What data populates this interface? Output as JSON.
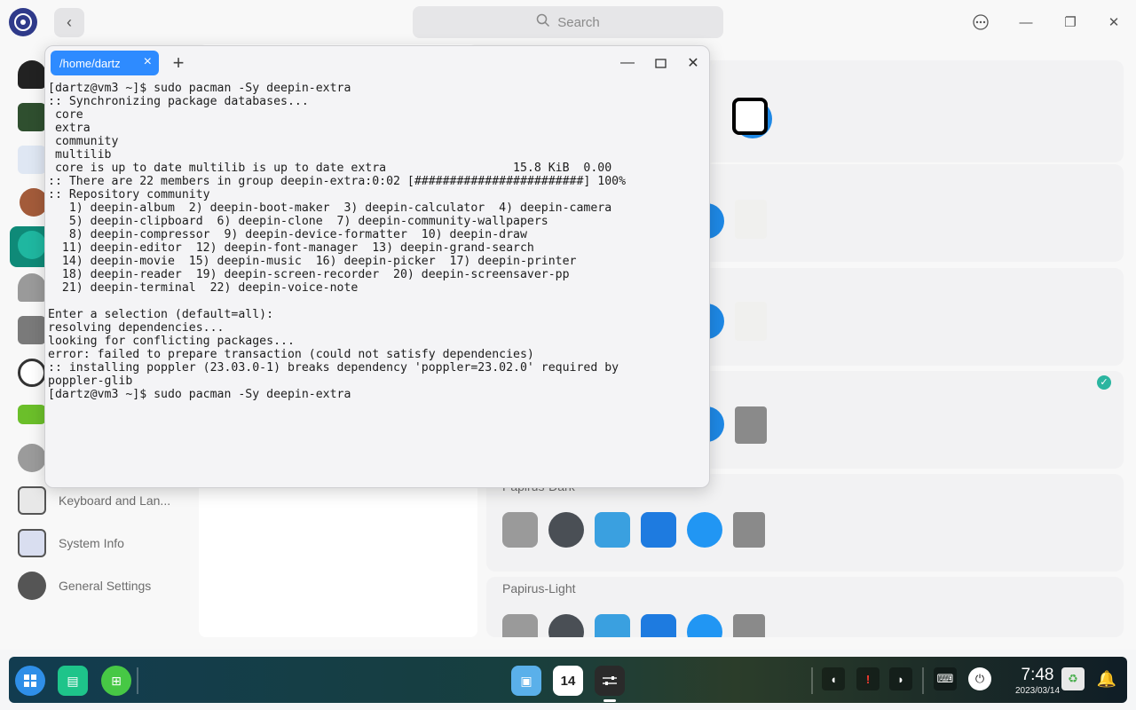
{
  "window": {
    "search_placeholder": "Search",
    "back_icon": "chevron-left-icon",
    "menu_icon": "more-icon",
    "min_icon": "minimize-icon",
    "max_icon": "maximize-icon",
    "close_icon": "close-icon"
  },
  "sidebar": {
    "items": [
      {
        "label": "Keyboard and Lan...",
        "icon": "keyboard-icon"
      },
      {
        "label": "System Info",
        "icon": "system-info-icon"
      },
      {
        "label": "General Settings",
        "icon": "gear-icon"
      }
    ]
  },
  "themes": {
    "items": [
      {
        "name": "Papirus-Dark"
      },
      {
        "name": "Papirus-Light"
      }
    ]
  },
  "terminal": {
    "tab_label": "/home/dartz",
    "close_tab": "×",
    "new_tab": "+",
    "output": "[dartz@vm3 ~]$ sudo pacman -Sy deepin-extra\n:: Synchronizing package databases...\n core\n extra\n community\n multilib\n core is up to date multilib is up to date extra                  15.8 KiB  0.00\n:: There are 22 members in group deepin-extra:0:02 [########################] 100%\n:: Repository community\n   1) deepin-album  2) deepin-boot-maker  3) deepin-calculator  4) deepin-camera\n   5) deepin-clipboard  6) deepin-clone  7) deepin-community-wallpapers\n   8) deepin-compressor  9) deepin-device-formatter  10) deepin-draw\n  11) deepin-editor  12) deepin-font-manager  13) deepin-grand-search\n  14) deepin-movie  15) deepin-music  16) deepin-picker  17) deepin-printer\n  18) deepin-reader  19) deepin-screen-recorder  20) deepin-screensaver-pp\n  21) deepin-terminal  22) deepin-voice-note\n\nEnter a selection (default=all):\nresolving dependencies...\nlooking for conflicting packages...\nerror: failed to prepare transaction (could not satisfy dependencies)\n:: installing poppler (23.03.0-1) breaks dependency 'poppler=23.02.0' required by\npoppler-glib\n[dartz@vm3 ~]$ sudo pacman -Sy deepin-extra"
  },
  "taskbar": {
    "time": "7:48",
    "date": "2023/03/14",
    "calendar_day": "14"
  },
  "colors": {
    "accent": "#2e8bff",
    "active_sidebar": "#0f8a78"
  }
}
